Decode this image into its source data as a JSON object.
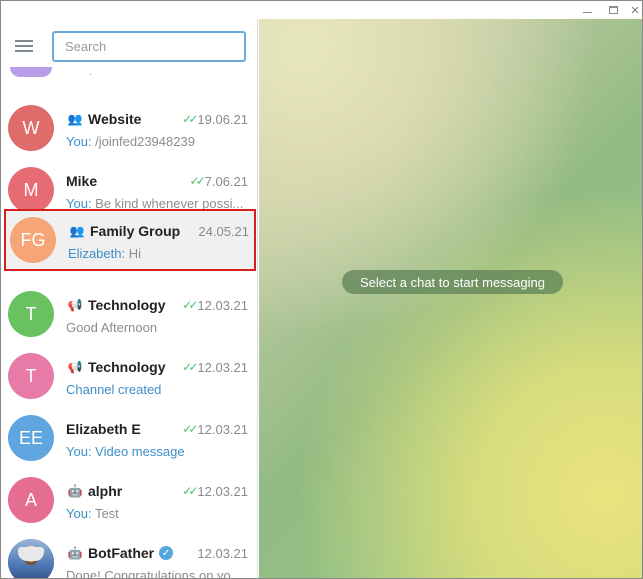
{
  "window": {
    "controls": [
      "minimize",
      "maximize",
      "close"
    ]
  },
  "search": {
    "placeholder": "Search"
  },
  "chats": [
    {
      "type_icon": "group-icon",
      "name": "Website",
      "checks": "✓✓",
      "date": "19.06.21",
      "who": "You:",
      "text": " /joinfed23948239",
      "avatar_text": "W",
      "avatar_color": "#df6b6b"
    },
    {
      "type_icon": "",
      "name": "Mike",
      "checks": "✓✓",
      "date": "7.06.21",
      "who": "You:",
      "text": " Be kind whenever possi...",
      "avatar_text": "M",
      "avatar_color": "#e76b73"
    },
    {
      "type_icon": "group-icon",
      "name": "Family Group",
      "checks": "",
      "date": "24.05.21",
      "who": "Elizabeth:",
      "text": " Hi",
      "avatar_text": "FG",
      "avatar_color": "#f5a576"
    },
    {
      "type_icon": "channel-icon",
      "name": "Technology",
      "checks": "✓✓",
      "date": "12.03.21",
      "who": "",
      "text": "Good Afternoon",
      "avatar_text": "T",
      "avatar_color": "#69c25f"
    },
    {
      "type_icon": "channel-icon",
      "name": "Technology",
      "checks": "✓✓",
      "date": "12.03.21",
      "who": "",
      "text": "Channel created",
      "avatar_text": "T",
      "avatar_color": "#e77aa6"
    },
    {
      "type_icon": "",
      "name": "Elizabeth E",
      "checks": "✓✓",
      "date": "12.03.21",
      "who": "You:",
      "text": " Video message",
      "avatar_text": "EE",
      "avatar_color": "#5fa6e0"
    },
    {
      "type_icon": "bot-icon",
      "name": "alphr",
      "checks": "✓✓",
      "date": "12.03.21",
      "who": "You:",
      "text": " Test",
      "avatar_text": "A",
      "avatar_color": "#e46d91"
    },
    {
      "type_icon": "bot-icon",
      "name": "BotFather",
      "checks": "",
      "date": "12.03.21",
      "who": "",
      "text": "Done! Congratulations on yo...",
      "avatar_text": "",
      "avatar_color": "#4d76b5"
    }
  ],
  "main": {
    "empty_hint": "Select a chat to start messaging"
  },
  "colors": {
    "accent": "#6aabd9",
    "link": "#3d8ec9",
    "read_check": "#4fc26a",
    "selection_border": "#d61f1f"
  }
}
